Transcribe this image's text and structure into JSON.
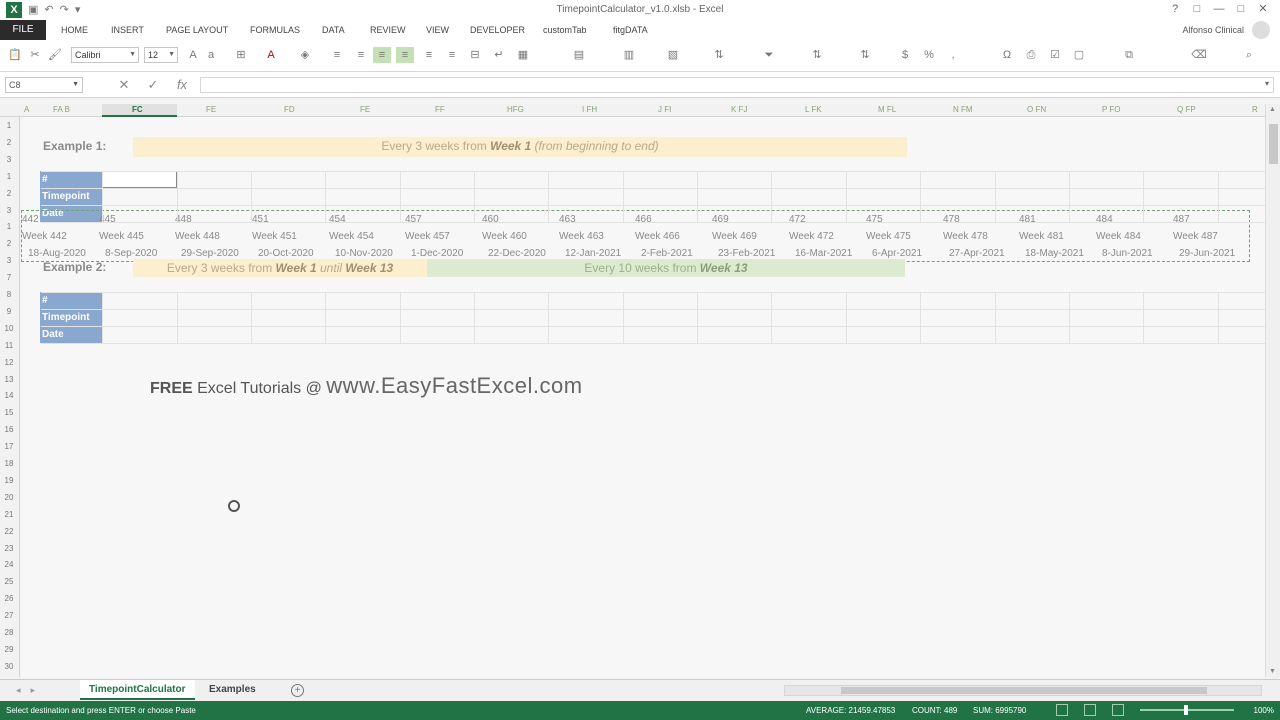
{
  "window": {
    "title": "TimepointCalculator_v1.0.xlsb - Excel",
    "controls": [
      "?",
      "□",
      "—",
      "□",
      "✕"
    ]
  },
  "ribbon_tabs": [
    "FILE",
    "HOME",
    "INSERT",
    "PAGE LAYOUT",
    "FORMULAS",
    "DATA",
    "REVIEW",
    "VIEW",
    "DEVELOPER",
    "customTab",
    "fitgDATA"
  ],
  "user": "Alfonso Clinical",
  "ribbon": {
    "font_name": "Calibri",
    "font_size": "12"
  },
  "formula_bar": {
    "name_box": "C8",
    "formula": ""
  },
  "columns": {
    "headers": [
      "A",
      "FA B",
      "FC",
      "FE",
      "FD",
      "FE",
      "FF",
      "HFG",
      "I FH",
      "J FI",
      "K FJ",
      "L FK",
      "M FL",
      "N FM",
      "O FN",
      "P FO",
      "Q FP",
      "R"
    ],
    "selected": "FC"
  },
  "rows": [
    "1",
    "2",
    "3",
    "1",
    "2",
    "3",
    "1",
    "2",
    "3",
    "7",
    "8",
    "9",
    "10",
    "11",
    "12",
    "13",
    "14",
    "15",
    "16",
    "17",
    "18",
    "19",
    "20",
    "21",
    "22",
    "23",
    "24",
    "25",
    "26",
    "27",
    "28",
    "29",
    "30",
    "31"
  ],
  "sheet": {
    "example1": {
      "label": "Example 1:",
      "banner_prefix": "Every 3 weeks from ",
      "banner_bold": "Week 1",
      "banner_suffix": " (from beginning to end)"
    },
    "example2": {
      "label": "Example 2:",
      "banner_yellow_prefix": "Every 3 weeks from ",
      "banner_yellow_bold1": "Week 1",
      "banner_yellow_mid": " until ",
      "banner_yellow_bold2": "Week 13",
      "banner_green_prefix": "Every 10 weeks from ",
      "banner_green_bold": "Week 13"
    },
    "header_labels": [
      "#",
      "Timepoint",
      "Date"
    ],
    "clipboard": {
      "numbers": [
        "442",
        "445",
        "448",
        "451",
        "454",
        "457",
        "460",
        "463",
        "466",
        "469",
        "472",
        "475",
        "478",
        "481",
        "484",
        "487"
      ],
      "weeks": [
        "Week 442",
        "Week 445",
        "Week 448",
        "Week 451",
        "Week 454",
        "Week 457",
        "Week 460",
        "Week 463",
        "Week 466",
        "Week 469",
        "Week 472",
        "Week 475",
        "Week 478",
        "Week 481",
        "Week 484",
        "Week 487"
      ],
      "dates": [
        "18-Aug-2020",
        "8-Sep-2020",
        "29-Sep-2020",
        "20-Oct-2020",
        "10-Nov-2020",
        "1-Dec-2020",
        "22-Dec-2020",
        "12-Jan-2021",
        "2-Feb-2021",
        "23-Feb-2021",
        "16-Mar-2021",
        "6-Apr-2021",
        "27-Apr-2021",
        "18-May-2021",
        "8-Jun-2021",
        "29-Jun-2021"
      ]
    },
    "promo": {
      "free": "FREE",
      "middle": " Excel Tutorials @ ",
      "url": "www.EasyFastExcel.com"
    }
  },
  "sheet_tabs": {
    "active": "TimepointCalculator",
    "other": "Examples"
  },
  "status_bar": {
    "message": "Select destination and press ENTER or choose Paste",
    "average": "AVERAGE: 21459.47853",
    "count": "COUNT: 489",
    "sum": "SUM: 6995790",
    "zoom": "100%"
  }
}
